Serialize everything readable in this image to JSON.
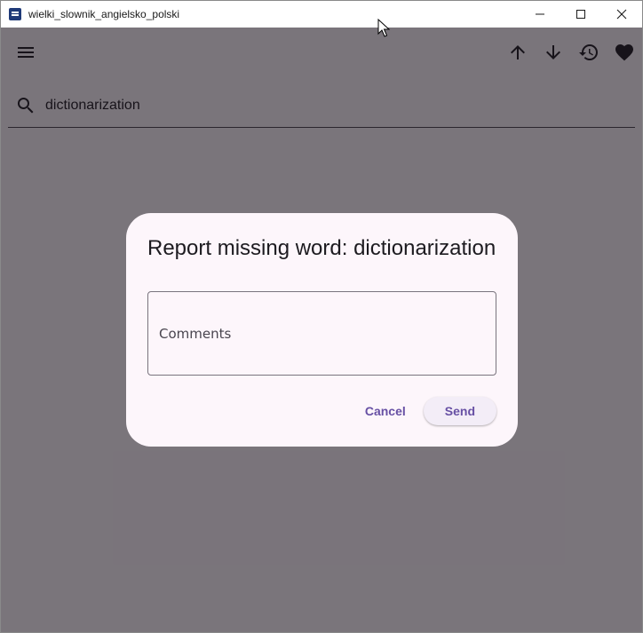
{
  "window": {
    "title": "wielki_slownik_angielsko_polski",
    "controls": [
      "minimize-icon",
      "maximize-icon",
      "close-icon"
    ]
  },
  "toolbar": {
    "icons": [
      "menu-icon",
      "arrow-up-icon",
      "arrow-down-icon",
      "history-icon",
      "heart-icon"
    ]
  },
  "search": {
    "value": "dictionarization",
    "icon": "search-icon"
  },
  "dialog": {
    "title": "Report missing word: dictionarization",
    "comments_label": "Comments",
    "cancel_label": "Cancel",
    "send_label": "Send"
  },
  "colors": {
    "accent": "#6750a4",
    "dialog_bg": "#fdf6fb",
    "scrim": "#7a7478",
    "app_icon": "#1f3a78"
  }
}
